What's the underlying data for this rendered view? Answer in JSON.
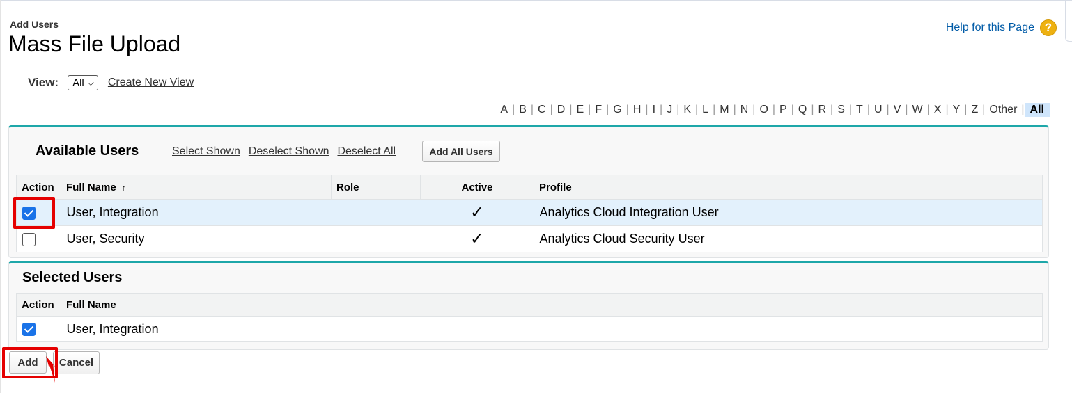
{
  "page": {
    "subtitle": "Add Users",
    "title": "Mass File Upload",
    "help_label": "Help for this Page",
    "help_icon": "help-icon"
  },
  "view": {
    "label": "View:",
    "selected": "All",
    "create_link": "Create New View"
  },
  "alphabet": [
    "A",
    "B",
    "C",
    "D",
    "E",
    "F",
    "G",
    "H",
    "I",
    "J",
    "K",
    "L",
    "M",
    "N",
    "O",
    "P",
    "Q",
    "R",
    "S",
    "T",
    "U",
    "V",
    "W",
    "X",
    "Y",
    "Z",
    "Other",
    "All"
  ],
  "alphabet_active": "All",
  "available": {
    "title": "Available Users",
    "links": [
      "Select Shown",
      "Deselect Shown",
      "Deselect All"
    ],
    "add_all_label": "Add All Users",
    "columns": [
      "Action",
      "Full Name",
      "Role",
      "Active",
      "Profile"
    ],
    "sort_indicator": "↑",
    "rows": [
      {
        "checked": true,
        "full_name": "User, Integration",
        "role": "",
        "active": "✓",
        "profile": "Analytics Cloud Integration User"
      },
      {
        "checked": false,
        "full_name": "User, Security",
        "role": "",
        "active": "✓",
        "profile": "Analytics Cloud Security User"
      }
    ]
  },
  "selected": {
    "title": "Selected Users",
    "columns": [
      "Action",
      "Full Name"
    ],
    "rows": [
      {
        "checked": true,
        "full_name": "User, Integration"
      }
    ]
  },
  "actions": {
    "add_label": "Add",
    "cancel_label": "Cancel"
  },
  "colors": {
    "accent_teal": "#1ea7a9",
    "highlight_red": "#e50000",
    "link_blue": "#015ba7",
    "checkbox_blue": "#1a73e8"
  }
}
